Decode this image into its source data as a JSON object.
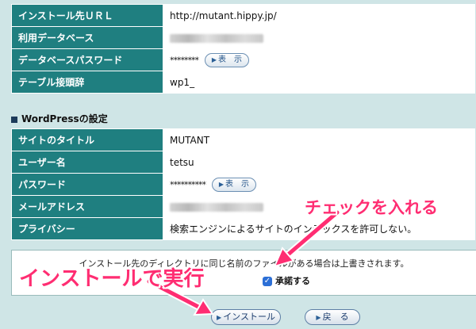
{
  "server_table": {
    "rows": [
      {
        "label": "インストール先ＵＲＬ",
        "value": "http://mutant.hippy.jp/"
      },
      {
        "label": "利用データベース",
        "value": ""
      },
      {
        "label": "データベースパスワード",
        "value": "********",
        "button": "表　示"
      },
      {
        "label": "テーブル接頭辞",
        "value": "wp1_"
      }
    ]
  },
  "wp_section": {
    "title": "WordPressの設定",
    "rows": [
      {
        "label": "サイトのタイトル",
        "value": "MUTANT"
      },
      {
        "label": "ユーザー名",
        "value": "tetsu"
      },
      {
        "label": "パスワード",
        "value": "**********",
        "button": "表　示"
      },
      {
        "label": "メールアドレス",
        "value": ""
      },
      {
        "label": "プライバシー",
        "value": "検索エンジンによるサイトのインデックスを許可しない。"
      }
    ]
  },
  "confirm": {
    "notice": "インストール先のディレクトリに同じ名前のファイルがある場合は上書きされます。",
    "agree_label": "承諾する",
    "agree_checked": true
  },
  "buttons": {
    "install": "インストール",
    "back": "戻　る"
  },
  "annotations": {
    "check_callout": "チェックを入れる",
    "install_callout": "インストールで実行",
    "color": "#ff2d72"
  },
  "icons": {
    "button_arrow": "play-arrow-icon",
    "checkbox": "check-icon"
  }
}
